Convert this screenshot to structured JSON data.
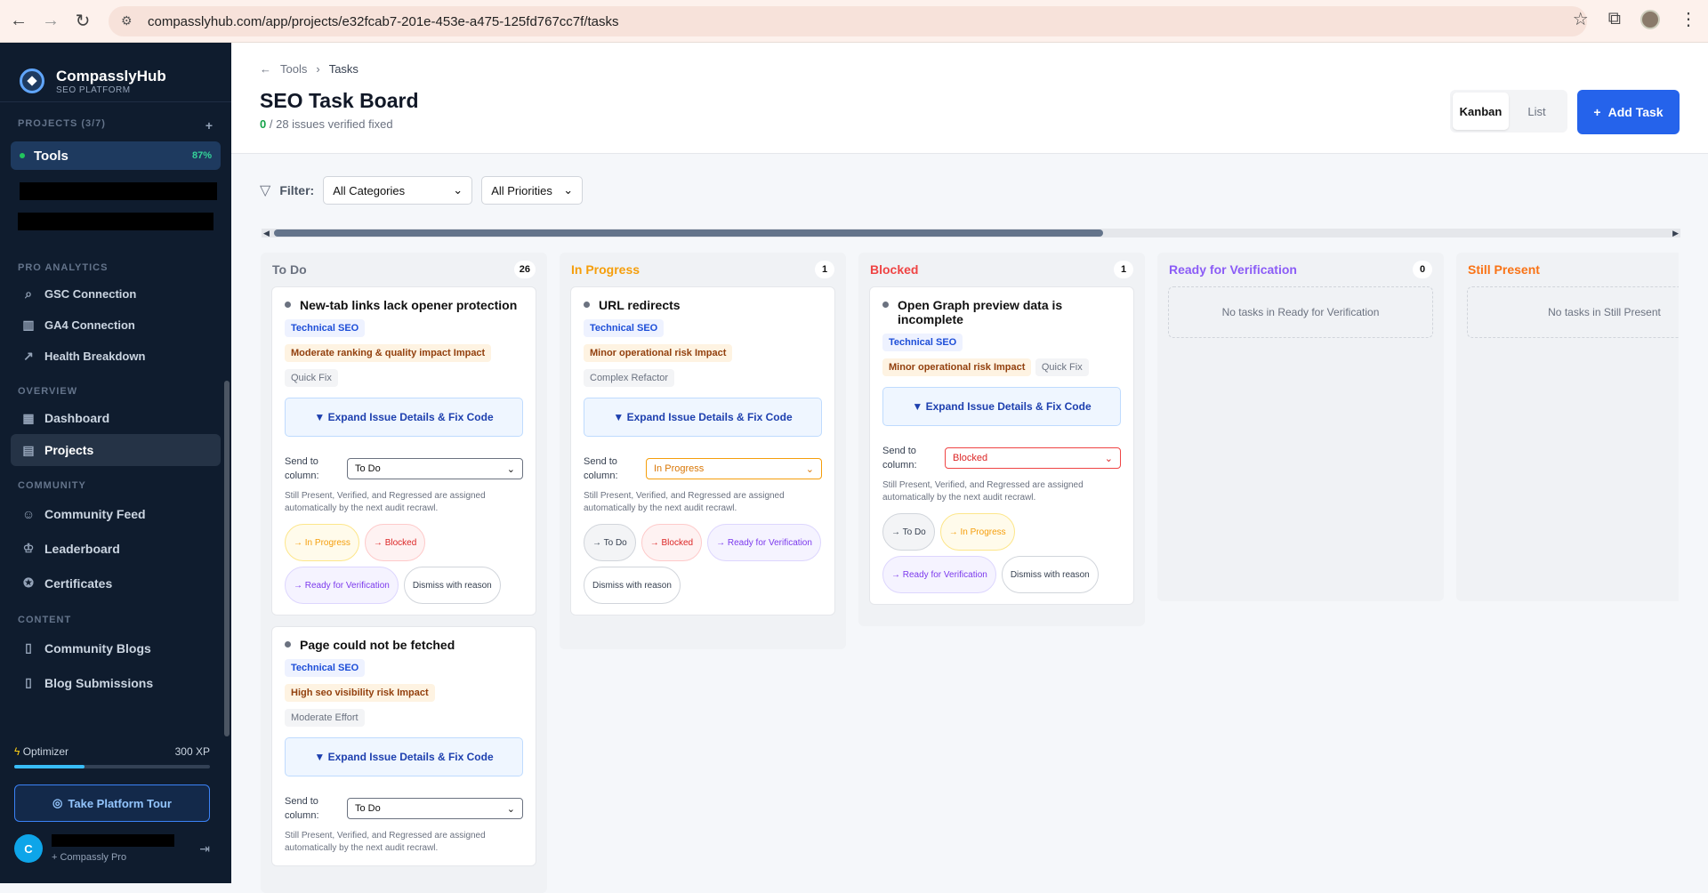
{
  "browser": {
    "url": "compasslyhub.com/app/projects/e32fcab7-201e-453e-a475-125fd767cc7f/tasks"
  },
  "sidebar": {
    "brand_name": "CompasslyHub",
    "brand_sub": "SEO PLATFORM",
    "projects_label": "PROJECTS (3/7)",
    "project": {
      "name": "Tools",
      "pct": "87%"
    },
    "pro_label": "PRO ANALYTICS",
    "pro_items": [
      {
        "label": "GSC Connection",
        "icon": "search-icon"
      },
      {
        "label": "GA4 Connection",
        "icon": "chart-icon"
      },
      {
        "label": "Health Breakdown",
        "icon": "trend-icon"
      }
    ],
    "overview_label": "OVERVIEW",
    "overview_items": [
      {
        "label": "Dashboard",
        "icon": "grid-icon"
      },
      {
        "label": "Projects",
        "icon": "folder-icon"
      }
    ],
    "community_label": "COMMUNITY",
    "community_items": [
      {
        "label": "Community Feed",
        "icon": "users-icon"
      },
      {
        "label": "Leaderboard",
        "icon": "trophy-icon"
      },
      {
        "label": "Certificates",
        "icon": "award-icon"
      }
    ],
    "content_label": "CONTENT",
    "content_items": [
      {
        "label": "Community Blogs",
        "icon": "book-icon"
      },
      {
        "label": "Blog Submissions",
        "icon": "book-open-icon"
      }
    ],
    "level": "Optimizer",
    "xp": "300 XP",
    "xp_progress": 0.36,
    "tour_label": "Take Platform Tour",
    "user_initial": "C",
    "user_plan": "+ Compassly Pro"
  },
  "header": {
    "crumb_parent": "Tools",
    "crumb_current": "Tasks",
    "title": "SEO Task Board",
    "verified_count": "0",
    "verified_rest": "/ 28 issues verified fixed",
    "view_kanban": "Kanban",
    "view_list": "List",
    "add_task": "Add Task"
  },
  "filters": {
    "label": "Filter:",
    "category": "All Categories",
    "priority": "All Priorities"
  },
  "board": {
    "columns": [
      {
        "title": "To Do",
        "count": "26",
        "color": "#6b7280"
      },
      {
        "title": "In Progress",
        "count": "1",
        "color": "#f59e0b"
      },
      {
        "title": "Blocked",
        "count": "1",
        "color": "#ef4444"
      },
      {
        "title": "Ready for Verification",
        "count": "0",
        "color": "#8b5cf6",
        "empty": "No tasks in Ready for Verification"
      },
      {
        "title": "Still Present",
        "color": "#f97316",
        "empty": "No tasks in Still Present"
      }
    ],
    "common": {
      "expand": "▼ Expand Issue Details & Fix Code",
      "send_label": "Send to column:",
      "note": "Still Present, Verified, and Regressed are assigned automatically by the next audit recrawl.",
      "to_todo": "→ To Do",
      "to_progress": "→ In Progress",
      "to_blocked": "→ Blocked",
      "to_ready": "→ Ready for Verification",
      "dismiss": "Dismiss with reason"
    },
    "cards": {
      "todo1": {
        "title": "New-tab links lack opener protection",
        "category": "Technical SEO",
        "impact": "Moderate ranking & quality impact Impact",
        "effort": "Quick Fix",
        "column": "To Do"
      },
      "todo2": {
        "title": "Page could not be fetched",
        "category": "Technical SEO",
        "impact": "High seo visibility risk Impact",
        "effort": "Moderate Effort",
        "column": "To Do"
      },
      "prog1": {
        "title": "URL redirects",
        "category": "Technical SEO",
        "impact": "Minor operational risk Impact",
        "effort": "Complex Refactor",
        "column": "In Progress"
      },
      "blk1": {
        "title": "Open Graph preview data is incomplete",
        "category": "Technical SEO",
        "impact": "Minor operational risk Impact",
        "effort": "Quick Fix",
        "column": "Blocked"
      }
    }
  }
}
